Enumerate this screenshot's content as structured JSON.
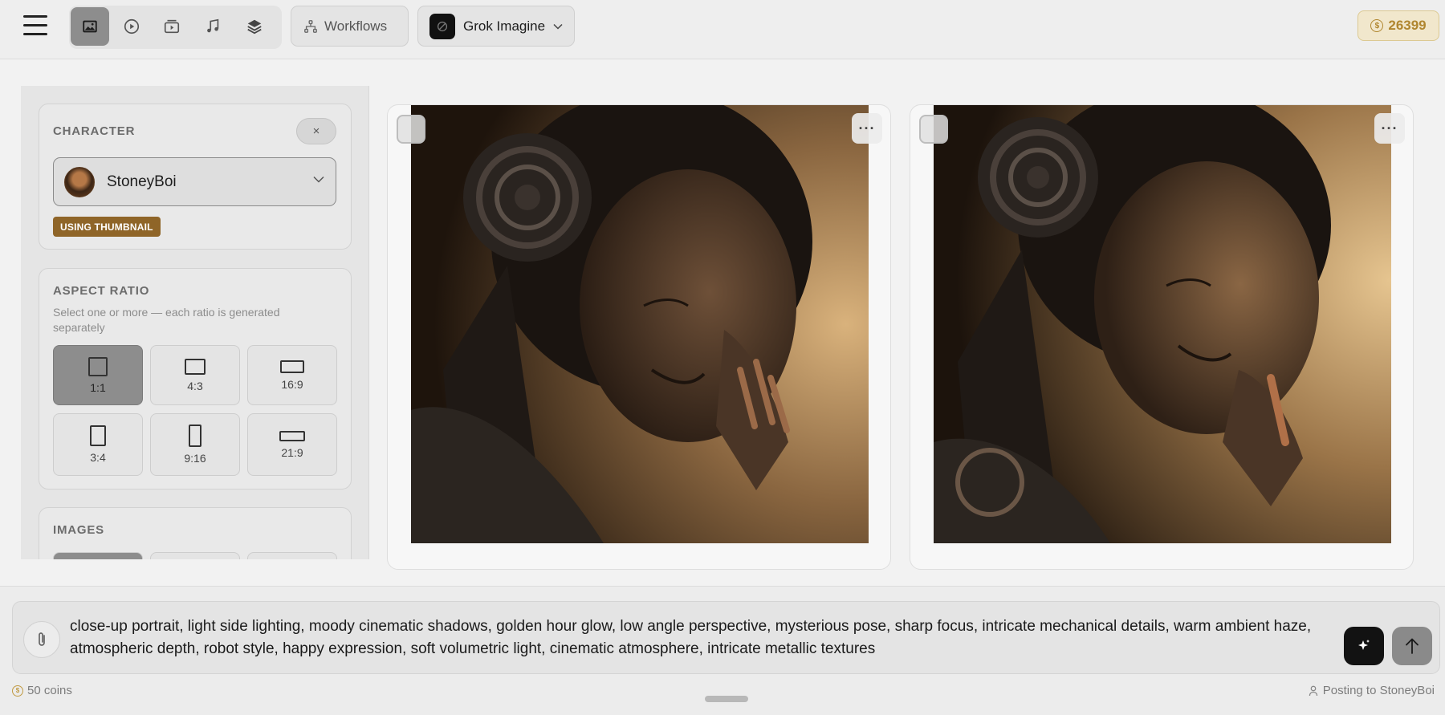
{
  "header": {
    "modes": [
      {
        "name": "image-mode",
        "icon": "image-icon",
        "active": true
      },
      {
        "name": "video-mode",
        "icon": "play-icon",
        "active": false
      },
      {
        "name": "slideshow-mode",
        "icon": "film-icon",
        "active": false
      },
      {
        "name": "music-mode",
        "icon": "music-note-icon",
        "active": false
      },
      {
        "name": "layers-mode",
        "icon": "layers-icon",
        "active": false
      }
    ],
    "workflows_label": "Workflows",
    "model_label": "Grok Imagine",
    "coins": "26399"
  },
  "sidebar": {
    "character": {
      "title": "CHARACTER",
      "close_label": "×",
      "selected": "StoneyBoi",
      "badge": "USING THUMBNAIL"
    },
    "aspect_ratio": {
      "title": "ASPECT RATIO",
      "subtitle": "Select one or more — each ratio is generated separately",
      "options": [
        "1:1",
        "4:3",
        "16:9",
        "3:4",
        "9:16",
        "21:9"
      ],
      "selected": "1:1"
    },
    "images": {
      "title": "IMAGES"
    }
  },
  "gallery": {
    "more_label": "···",
    "items": [
      {
        "alt": "robot portrait 1"
      },
      {
        "alt": "robot portrait 2"
      }
    ]
  },
  "prompt": {
    "text": "close-up portrait, light side lighting, moody cinematic shadows, golden hour glow, low angle perspective, mysterious pose, sharp focus, intricate mechanical details, warm ambient haze, atmospheric depth, robot style, happy expression, soft volumetric light, cinematic atmosphere, intricate metallic textures"
  },
  "footer": {
    "cost": "50 coins",
    "posting": "Posting to StoneyBoi"
  },
  "colors": {
    "accent_gold": "#b0862f",
    "badge_brown": "#8f6528",
    "selected_gray": "#8d8d8d"
  }
}
